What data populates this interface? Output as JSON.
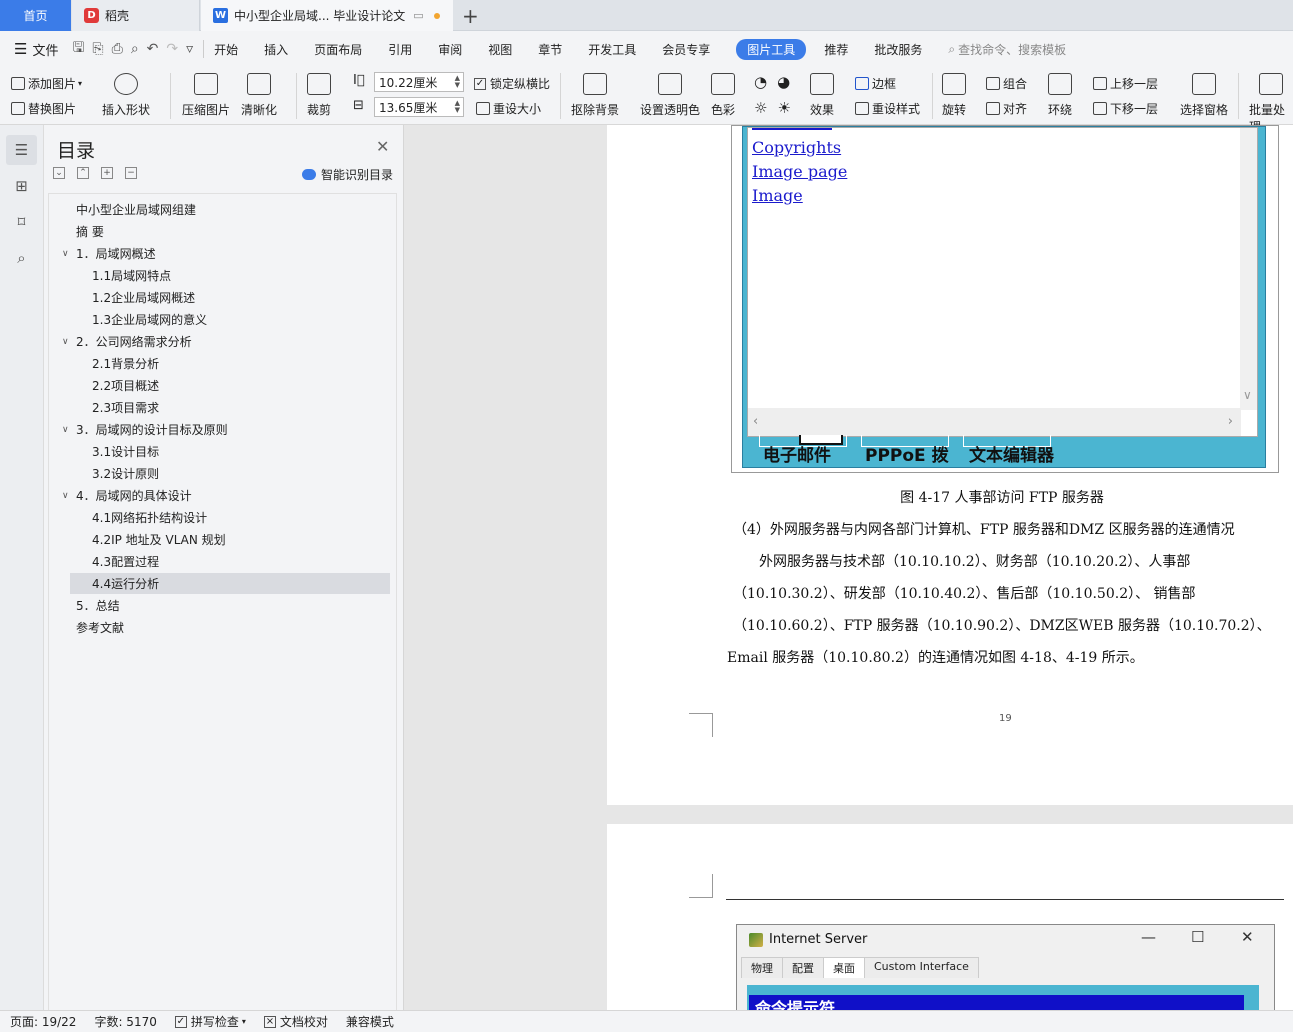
{
  "tabs": {
    "home": "首页",
    "daoke": "稻壳",
    "doc": "中小型企业局域... 毕业设计论文",
    "add": "+"
  },
  "menu": {
    "file": "文件",
    "items": [
      "开始",
      "插入",
      "页面布局",
      "引用",
      "审阅",
      "视图",
      "章节",
      "开发工具",
      "会员专享"
    ],
    "active": "图片工具",
    "after": [
      "推荐",
      "批改服务"
    ],
    "search": "查找命令、搜索模板"
  },
  "ribbon": {
    "add_image": "添加图片",
    "replace_image": "替换图片",
    "insert_shape": "插入形状",
    "compress": "压缩图片",
    "sharpen": "清晰化",
    "crop": "裁剪",
    "width": "10.22厘米",
    "height": "13.65厘米",
    "lock_ratio": "锁定纵横比",
    "reset_size": "重设大小",
    "remove_bg": "抠除背景",
    "set_transparent": "设置透明色",
    "color": "色彩",
    "effects": "效果",
    "border": "边框",
    "reset_style": "重设样式",
    "rotate": "旋转",
    "group": "组合",
    "align": "对齐",
    "wrap": "环绕",
    "bring_forward": "上移一层",
    "send_backward": "下移一层",
    "selection_pane": "选择窗格",
    "batch": "批量处理"
  },
  "toc": {
    "title": "目录",
    "smart": "智能识别目录",
    "items": [
      {
        "text": "中小型企业局域网组建",
        "level": 0
      },
      {
        "text": "摘  要",
        "level": 0
      },
      {
        "text": "1．局域网概述",
        "level": 1
      },
      {
        "text": "1.1局域网特点",
        "level": 2
      },
      {
        "text": "1.2企业局域网概述",
        "level": 2
      },
      {
        "text": "1.3企业局域网的意义",
        "level": 2
      },
      {
        "text": "2．公司网络需求分析",
        "level": 1
      },
      {
        "text": "2.1背景分析",
        "level": 2
      },
      {
        "text": "2.2项目概述",
        "level": 2
      },
      {
        "text": "2.3项目需求",
        "level": 2
      },
      {
        "text": "3．局域网的设计目标及原则",
        "level": 1
      },
      {
        "text": "3.1设计目标",
        "level": 2
      },
      {
        "text": "3.2设计原则",
        "level": 2
      },
      {
        "text": "4．局域网的具体设计",
        "level": 1
      },
      {
        "text": "4.1网络拓扑结构设计",
        "level": 2
      },
      {
        "text": "4.2IP 地址及 VLAN 规划",
        "level": 2
      },
      {
        "text": "4.3配置过程",
        "level": 2
      },
      {
        "text": "4.4运行分析",
        "level": 2
      },
      {
        "text": "5．总结",
        "level": 0
      },
      {
        "text": "参考文献",
        "level": 0
      }
    ]
  },
  "document": {
    "links": [
      "Copyrights",
      "Image page",
      "Image"
    ],
    "desk_labels": [
      "电子邮件",
      "PPPoE 拨",
      "文本编辑器"
    ],
    "caption": "图 4-17 人事部访问 FTP 服务器",
    "para1": "（4）外网服务器与内网各部门计算机、FTP 服务器和DMZ 区服务器的连通情况",
    "para2": "外网服务器与技术部（10.10.10.2）、财务部（10.10.20.2）、人事部",
    "para3": "（10.10.30.2）、研发部（10.10.40.2）、售后部（10.10.50.2）、 销售部",
    "para4": "（10.10.60.2）、FTP 服务器（10.10.90.2）、DMZ区WEB 服务器（10.10.70.2）、",
    "para5": "Email 服务器（10.10.80.2）的连通情况如图 4-18、4-19 所示。",
    "page_number": "19"
  },
  "window": {
    "title": "Internet Server",
    "tabs": [
      "物理",
      "配置",
      "桌面",
      "Custom Interface"
    ],
    "active_tab": "桌面",
    "cmd": "命令提示符"
  },
  "status": {
    "page": "页面: 19/22",
    "words": "字数: 5170",
    "spell": "拼写检查",
    "proof": "文档校对",
    "compat": "兼容模式"
  }
}
